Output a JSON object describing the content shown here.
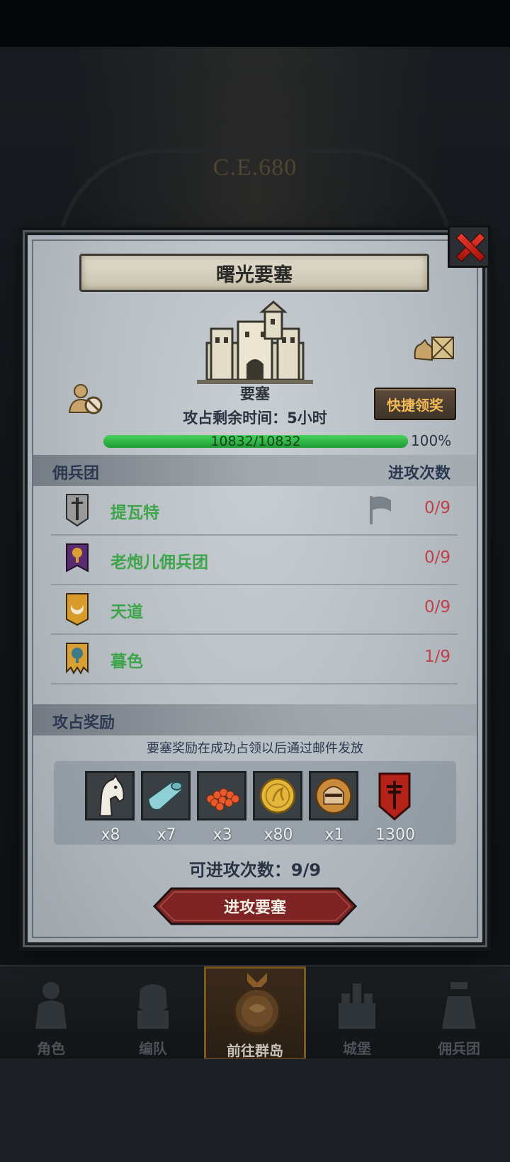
{
  "background": {
    "year_text": "C.E.680"
  },
  "modal": {
    "title": "曙光要塞",
    "castle_label": "要塞",
    "quick_claim_label": "快捷领奖",
    "remaining_time": "攻占剩余时间：5小时",
    "hp": {
      "text": "10832/10832",
      "percent_text": "100%",
      "fraction": 1.0
    },
    "mercenary_section": {
      "title": "佣兵团",
      "attacks_header": "进攻次数"
    },
    "mercenaries": [
      {
        "name": "提瓦特",
        "count": "0/9",
        "emblem": "sword-emblem",
        "color": "#8e8e8e"
      },
      {
        "name": "老炮儿佣兵团",
        "count": "0/9",
        "emblem": "tree-emblem",
        "color": "#5a2b6e"
      },
      {
        "name": "天道",
        "count": "0/9",
        "emblem": "moon-emblem",
        "color": "#d89b2a"
      },
      {
        "name": "暮色",
        "count": "1/9",
        "emblem": "tree-emblem",
        "color": "#d8a032"
      }
    ],
    "reward_section": {
      "title": "攻占奖励",
      "note": "要塞奖励在成功占领以后通过邮件发放",
      "items": [
        {
          "icon": "horse-icon",
          "qty": "x8"
        },
        {
          "icon": "cloth-icon",
          "qty": "x7"
        },
        {
          "icon": "berries-icon",
          "qty": "x3"
        },
        {
          "icon": "gold-coin-icon",
          "qty": "x80"
        },
        {
          "icon": "knight-helmet-icon",
          "qty": "x1"
        },
        {
          "icon": "honor-banner-icon",
          "qty": "1300"
        }
      ]
    },
    "attack_count": "可进攻次数：9/9",
    "attack_button": "进攻要塞"
  },
  "nav": {
    "items": [
      {
        "label": "角色",
        "icon": "character-icon"
      },
      {
        "label": "编队",
        "icon": "formation-icon"
      },
      {
        "label": "前往群岛",
        "icon": "islands-icon",
        "active": true
      },
      {
        "label": "城堡",
        "icon": "castle-icon"
      },
      {
        "label": "佣兵团",
        "icon": "mercenary-icon"
      }
    ]
  },
  "colors": {
    "accent_green": "#3ea54a",
    "count_red": "#c0404a",
    "claim_gold": "#f2b955",
    "attack_button": "#8a2a2a"
  }
}
